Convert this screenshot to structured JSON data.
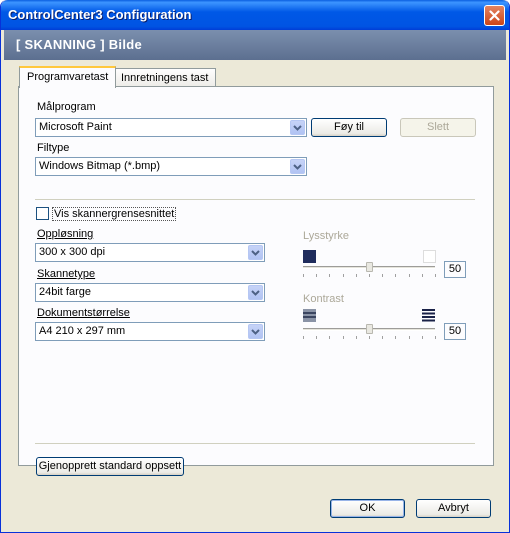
{
  "window": {
    "title": "ControlCenter3 Configuration"
  },
  "header": {
    "text": "[  SKANNING  ]   Bilde"
  },
  "tabs": [
    {
      "label": "Programvaretast",
      "active": true
    },
    {
      "label": "Innretningens tast",
      "active": false
    }
  ],
  "target_app": {
    "label": "Målprogram",
    "value": "Microsoft Paint",
    "add_label": "Føy til",
    "delete_label": "Slett"
  },
  "file_type": {
    "label": "Filtype",
    "value": "Windows Bitmap (*.bmp)"
  },
  "show_scanner_ui": {
    "label": "Vis skannergrensesnittet",
    "checked": false
  },
  "resolution": {
    "label": "Oppløsning",
    "value": "300 x 300 dpi"
  },
  "scan_type": {
    "label": "Skannetype",
    "value": "24bit farge"
  },
  "doc_size": {
    "label": "Dokumentstørrelse",
    "value": "A4 210 x 297 mm"
  },
  "brightness": {
    "label": "Lysstyrke",
    "value": "50",
    "level": 0.5
  },
  "contrast": {
    "label": "Kontrast",
    "value": "50",
    "level": 0.5
  },
  "restore_defaults_label": "Gjenopprett standard oppsett",
  "ok_label": "OK",
  "cancel_label": "Avbryt",
  "colors": {
    "titlebar": "#0054e3",
    "dialog_bg": "#ece9d8",
    "header_band": "#6a7d9e",
    "tab_highlight": "#ffc83c"
  }
}
